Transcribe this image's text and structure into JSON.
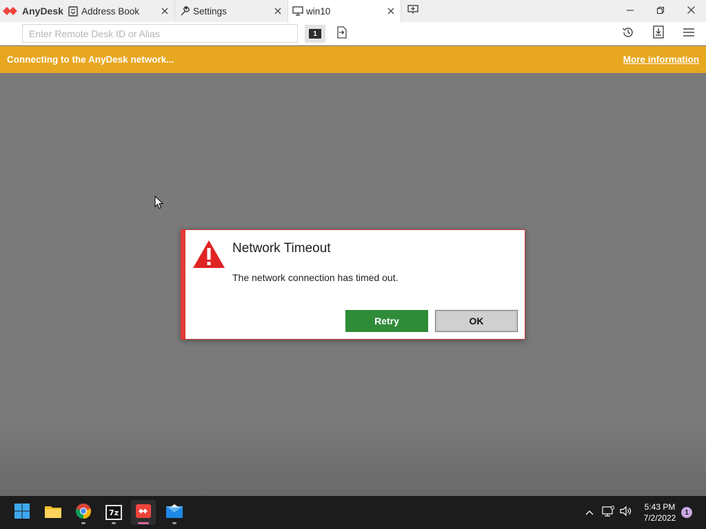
{
  "app": {
    "name": "AnyDesk",
    "brand_color": "#ef443b"
  },
  "tabs": [
    {
      "label": "Address Book",
      "icon": "address-book-icon"
    },
    {
      "label": "Settings",
      "icon": "wrench-icon"
    },
    {
      "label": "win10",
      "icon": "monitor-icon",
      "active": true
    }
  ],
  "toolbar": {
    "address_placeholder": "Enter Remote Desk ID or Alias",
    "address_value": "",
    "monitor_badge": "1",
    "right_icons": [
      "history-icon",
      "download-icon",
      "menu-icon"
    ]
  },
  "banner": {
    "text": "Connecting to the AnyDesk network...",
    "link": "More information",
    "color": "#e8a720"
  },
  "dialog": {
    "title": "Network Timeout",
    "message": "The network connection has timed out.",
    "retry_label": "Retry",
    "ok_label": "OK",
    "retry_color": "#2e8b38",
    "icon": "warning-icon"
  },
  "taskbar": {
    "apps": [
      "start-icon",
      "file-explorer-icon",
      "chrome-icon",
      "7zip-icon",
      "anydesk-icon",
      "mail-icon"
    ],
    "sevenzip_label": "7z",
    "time": "5:43 PM",
    "date": "7/2/2022",
    "notification_count": "1"
  }
}
